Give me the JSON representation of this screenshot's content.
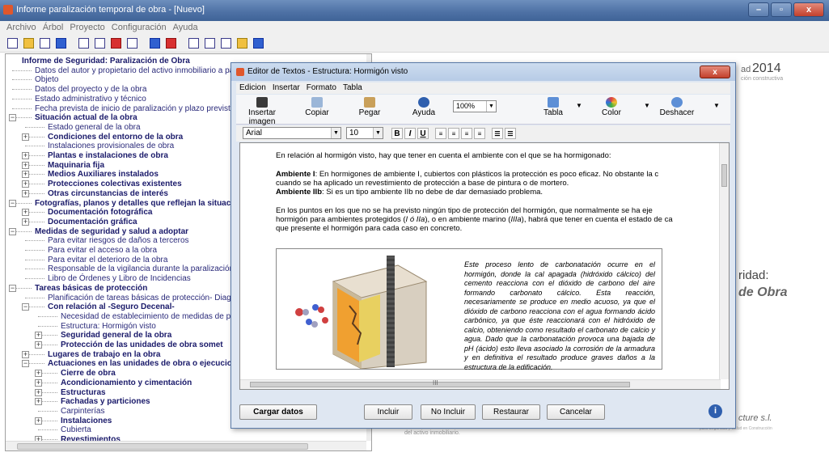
{
  "window": {
    "title": "Informe paralización temporal de obra - [Nuevo]",
    "buttons": {
      "minimize": "–",
      "maximize": "▫",
      "close": "x"
    }
  },
  "menu": [
    "Archivo",
    "Árbol",
    "Proyecto",
    "Configuración",
    "Ayuda"
  ],
  "tree": {
    "items": [
      {
        "level": 0,
        "label": "Informe de Seguridad: Paralización de Obra",
        "bold": true,
        "expander": ""
      },
      {
        "level": 1,
        "label": "Datos del autor y propietario del activo inmobiliario a paralizar",
        "bold": false,
        "expander": ""
      },
      {
        "level": 1,
        "label": "Objeto",
        "bold": false,
        "expander": ""
      },
      {
        "level": 1,
        "label": "Datos del proyecto y de la obra",
        "bold": false,
        "expander": ""
      },
      {
        "level": 1,
        "label": "Estado administrativo y técnico",
        "bold": false,
        "expander": ""
      },
      {
        "level": 1,
        "label": "Fecha prevista de inicio de paralización y plazo previsto",
        "bold": false,
        "expander": ""
      },
      {
        "level": 1,
        "label": "Situación actual de la obra",
        "bold": true,
        "expander": "−"
      },
      {
        "level": 2,
        "label": "Estado general de la obra",
        "bold": false,
        "expander": ""
      },
      {
        "level": 2,
        "label": "Condiciones del entorno de la obra",
        "bold": true,
        "expander": "+"
      },
      {
        "level": 2,
        "label": "Instalaciones provisionales de obra",
        "bold": false,
        "expander": ""
      },
      {
        "level": 2,
        "label": "Plantas e instalaciones de obra",
        "bold": true,
        "expander": "+"
      },
      {
        "level": 2,
        "label": "Maquinaria fija",
        "bold": true,
        "expander": "+"
      },
      {
        "level": 2,
        "label": "Medios Auxiliares instalados",
        "bold": true,
        "expander": "+"
      },
      {
        "level": 2,
        "label": "Protecciones colectivas existentes",
        "bold": true,
        "expander": "+"
      },
      {
        "level": 2,
        "label": "Otras circunstancias de interés",
        "bold": true,
        "expander": "+"
      },
      {
        "level": 1,
        "label": "Fotografías, planos y detalles que reflejan la situación",
        "bold": true,
        "expander": "−"
      },
      {
        "level": 2,
        "label": "Documentación fotográfica",
        "bold": true,
        "expander": "+"
      },
      {
        "level": 2,
        "label": "Documentación gráfica",
        "bold": true,
        "expander": "+"
      },
      {
        "level": 1,
        "label": "Medidas de seguridad y salud a adoptar",
        "bold": true,
        "expander": "−"
      },
      {
        "level": 2,
        "label": "Para evitar riesgos de daños a terceros",
        "bold": false,
        "expander": ""
      },
      {
        "level": 2,
        "label": "Para evitar el acceso a la obra",
        "bold": false,
        "expander": ""
      },
      {
        "level": 2,
        "label": "Para evitar el deterioro de la obra",
        "bold": false,
        "expander": ""
      },
      {
        "level": 2,
        "label": "Responsable de la vigilancia durante la paralización",
        "bold": false,
        "expander": ""
      },
      {
        "level": 2,
        "label": "Libro de Órdenes y Libro de Incidencias",
        "bold": false,
        "expander": ""
      },
      {
        "level": 1,
        "label": "Tareas básicas de protección",
        "bold": true,
        "expander": "−"
      },
      {
        "level": 2,
        "label": "Planificación de tareas básicas de protección- Diagrama d",
        "bold": false,
        "expander": ""
      },
      {
        "level": 2,
        "label": "Con relación al -Seguro Decenal-",
        "bold": true,
        "expander": "−"
      },
      {
        "level": 3,
        "label": "Necesidad de establecimiento de medidas de prot",
        "bold": false,
        "expander": ""
      },
      {
        "level": 3,
        "label": "Estructura: Hormigón visto",
        "bold": false,
        "expander": ""
      },
      {
        "level": 3,
        "label": "Seguridad general de la obra",
        "bold": true,
        "expander": "+"
      },
      {
        "level": 3,
        "label": "Protección de las unidades de obra somet",
        "bold": true,
        "expander": "+"
      },
      {
        "level": 2,
        "label": "Lugares de trabajo en la obra",
        "bold": true,
        "expander": "+"
      },
      {
        "level": 2,
        "label": "Actuaciones en las unidades de obra o ejecucio",
        "bold": true,
        "expander": "−"
      },
      {
        "level": 3,
        "label": "Cierre de obra",
        "bold": true,
        "expander": "+"
      },
      {
        "level": 3,
        "label": "Acondicionamiento y cimentación",
        "bold": true,
        "expander": "+"
      },
      {
        "level": 3,
        "label": "Estructuras",
        "bold": true,
        "expander": "+"
      },
      {
        "level": 3,
        "label": "Fachadas y particiones",
        "bold": true,
        "expander": "+"
      },
      {
        "level": 3,
        "label": "Carpinterías",
        "bold": false,
        "expander": ""
      },
      {
        "level": 3,
        "label": "Instalaciones",
        "bold": true,
        "expander": "+"
      },
      {
        "level": 3,
        "label": "Cubierta",
        "bold": false,
        "expander": ""
      },
      {
        "level": 3,
        "label": "Revestimientos",
        "bold": true,
        "expander": "+"
      }
    ],
    "scroll_h": "III"
  },
  "background": {
    "year": "2014",
    "year_prefix": "ad",
    "sub": "ción constructiva",
    "ridad": "ridad:",
    "obra": "de Obra",
    "cture": "cture s.l.",
    "cture_sub": "para Seguridad y Salud en Construcción",
    "foot": "del activo inmobiliario."
  },
  "dialog": {
    "title": "Editor de Textos - Estructura: Hormigón visto",
    "close": "x",
    "menu": [
      "Edicion",
      "Insertar",
      "Formato",
      "Tabla"
    ],
    "ribbon": {
      "insert_image": "Insertar imagen",
      "copy": "Copiar",
      "paste": "Pegar",
      "help": "Ayuda",
      "zoom": "100%",
      "table": "Tabla",
      "color": "Color",
      "undo": "Deshacer"
    },
    "format": {
      "font": "Arial",
      "size": "10",
      "bold": "B",
      "italic": "I",
      "underline": "U"
    },
    "content": {
      "intro": "En relación al hormigón visto, hay que tener en cuenta el ambiente con el que se ha hormigonado:",
      "amb1_label": "Ambiente I",
      "amb1_text": ": En hormigones de ambiente I, cubiertos con plásticos la protección es poco eficaz. No obstante la c",
      "amb1_line2": "cuando se ha aplicado un revestimiento de protección a base de pintura o de mortero.",
      "amb2_label": "Ambiente IIb",
      "amb2_text": ": Si es un tipo ambiente IIb no debe de dar demasiado problema.",
      "para3_a": "En los puntos en los  que no se ha previsto ningún tipo de protección del hormigón, que normalmente se ha eje",
      "para3_b1": "hormigón para ambientes protegidos (",
      "para3_b_it1": "I ó IIa",
      "para3_b2": "), o en ambiente marino (",
      "para3_b_it2": "IIIa",
      "para3_b3": "), habrá que tener en cuenta el estado de ca",
      "para3_c": "que presente el hormigón para cada caso en concreto.",
      "caption": "Este proceso lento de carbonatación ocurre en el hormigón, donde la cal apagada (hidróxido cálcico) del cemento reacciona con el dióxido de carbono del aire formando carbonato cálcico. Esta reacción, necesariamente se produce en medio acuoso, ya que el dióxido de carbono reacciona con el agua formando ácido carbónico, ya que éste reaccionará con el hidróxido de calcio, obteniendo como resultado el carbonato de calcio y agua. Dado que la carbonatación provoca una bajada de pH (ácido) esto lleva asociado la corrosión de la armadura y en definitiva el resultado produce graves daños a la estructura de la edificación.",
      "scroll_mid": "III"
    },
    "buttons": {
      "load": "Cargar datos",
      "include": "Incluir",
      "not_include": "No Incluir",
      "restore": "Restaurar",
      "cancel": "Cancelar",
      "info": "i"
    }
  },
  "colors": {
    "titlebar": "#4f72a6",
    "tree_bold": "#1a1a6a",
    "close_red": "#c2402c"
  }
}
